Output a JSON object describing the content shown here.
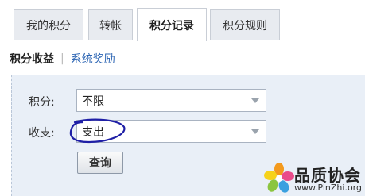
{
  "tabs": [
    {
      "label": "我的积分",
      "active": false
    },
    {
      "label": "转帐",
      "active": false
    },
    {
      "label": "积分记录",
      "active": true
    },
    {
      "label": "积分规则",
      "active": false
    }
  ],
  "subnav": {
    "current": "积分收益",
    "separator": "|",
    "link": "系统奖励"
  },
  "filters": {
    "points_label": "积分:",
    "points_value": "不限",
    "type_label": "收支:",
    "type_value": "支出",
    "query_button": "查询"
  },
  "watermark": {
    "name": "品质协会",
    "url": "www.PinZhi.org"
  },
  "colors": {
    "panel_bg": "#e9eff7",
    "link": "#2b64b3",
    "annotation_ink": "#1f1fa6"
  }
}
